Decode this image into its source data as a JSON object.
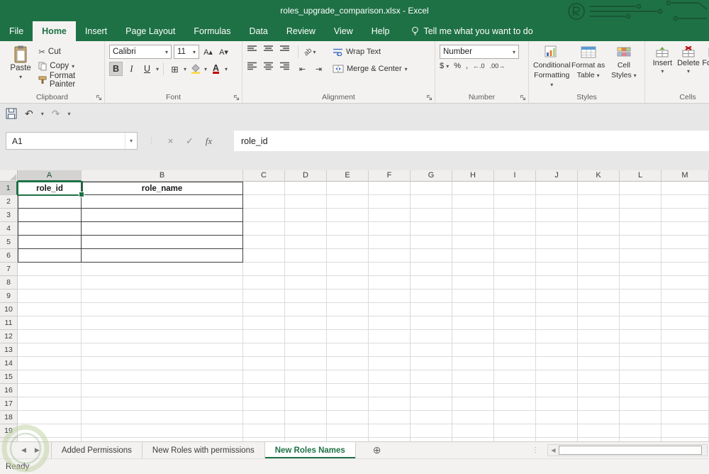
{
  "titlebar": {
    "title": "roles_upgrade_comparison.xlsx  -  Excel"
  },
  "menubar": {
    "tabs": [
      "File",
      "Home",
      "Insert",
      "Page Layout",
      "Formulas",
      "Data",
      "Review",
      "View",
      "Help"
    ],
    "active_tab": "Home",
    "tell_me": "Tell me what you want to do"
  },
  "ribbon": {
    "groups": {
      "clipboard": {
        "label": "Clipboard",
        "paste": "Paste",
        "cut": "Cut",
        "copy": "Copy",
        "format_painter": "Format Painter"
      },
      "font": {
        "label": "Font",
        "font_name": "Calibri",
        "font_size": "11",
        "bold": "B",
        "italic": "I",
        "underline": "U"
      },
      "alignment": {
        "label": "Alignment",
        "orientation": "ab",
        "wrap_text": "Wrap Text",
        "merge_center": "Merge & Center"
      },
      "number": {
        "label": "Number",
        "format": "Number",
        "currency": "$",
        "percent": "%",
        "comma": ",",
        "increase_decimal": "←.0",
        "decrease_decimal": ".00→"
      },
      "styles": {
        "label": "Styles",
        "conditional_1": "Conditional",
        "conditional_2": "Formatting",
        "format_table_1": "Format as",
        "format_table_2": "Table",
        "cell_styles_1": "Cell",
        "cell_styles_2": "Styles"
      },
      "cells": {
        "label": "Cells",
        "insert": "Insert",
        "delete": "Delete",
        "format": "Format"
      }
    }
  },
  "formula_bar": {
    "name_box": "A1",
    "cancel": "×",
    "enter": "✓",
    "fx": "fx",
    "content": "role_id"
  },
  "grid": {
    "columns": [
      "A",
      "B",
      "C",
      "D",
      "E",
      "F",
      "G",
      "H",
      "I",
      "J",
      "K",
      "L",
      "M"
    ],
    "row_count": 20,
    "cells": {
      "A1": "role_id",
      "B1": "role_name"
    },
    "selection": "A1",
    "selected_column": "A",
    "selected_row": 1,
    "table_range": "A1:B6",
    "table_rows": 6,
    "table_cols": 2
  },
  "sheet_tabs": {
    "tabs": [
      {
        "label": "Added Permissions",
        "active": false
      },
      {
        "label": "New Roles with permissions",
        "active": false
      },
      {
        "label": "New Roles Names",
        "active": true
      }
    ]
  },
  "status_bar": {
    "status": "Ready"
  },
  "colors": {
    "excel_green": "#1e7145",
    "table_border": "#3f3f3f",
    "grid_line": "#dbdbdb"
  },
  "glyphs": {
    "dropdown": "▾",
    "cut": "✂",
    "undo": "↶",
    "redo": "↷",
    "customize": "▾",
    "separator": "⋮",
    "borders": "⊞",
    "size_up": "A▴",
    "size_down": "A▾",
    "indent_decrease": "⇤",
    "indent_increase": "⇥",
    "add_sheet": "⊕",
    "tab_prev": "◀",
    "tab_next": "▶",
    "scroll_left": "◀",
    "dots": "⋮"
  }
}
